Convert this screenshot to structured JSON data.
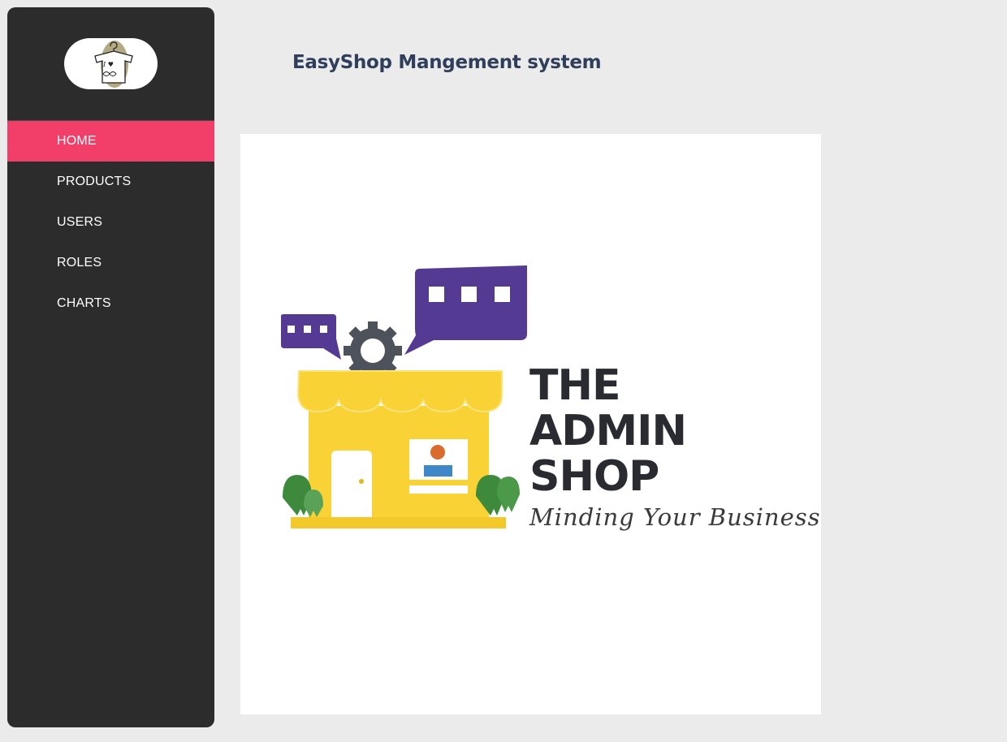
{
  "app": {
    "title": "EasyShop Mangement system"
  },
  "sidebar": {
    "logo": {
      "icon": "tshirt-hanger-logo",
      "text": "I ♥ ∞"
    },
    "items": [
      {
        "label": "HOME",
        "active": true
      },
      {
        "label": "PRODUCTS",
        "active": false
      },
      {
        "label": "USERS",
        "active": false
      },
      {
        "label": "ROLES",
        "active": false
      },
      {
        "label": "CHARTS",
        "active": false
      }
    ]
  },
  "hero": {
    "image": "admin-shop-storefront-illustration",
    "brand_lines": [
      "THE",
      "ADMIN",
      "SHOP"
    ],
    "tagline": "Minding Your Business"
  },
  "colors": {
    "sidebar_bg": "#2c2c2c",
    "active_item": "#f23f6a",
    "page_bg": "#ebebeb",
    "title": "#2f3e5a",
    "awning_yellow": "#f9d235",
    "bubble_purple": "#5a3a96",
    "tree_green": "#3d8a3c"
  }
}
